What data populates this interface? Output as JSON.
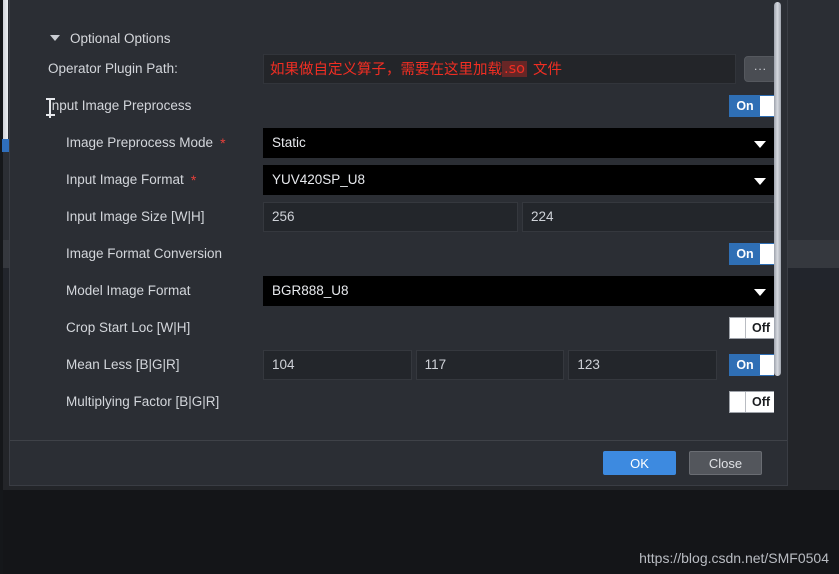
{
  "dialog": {
    "section_header": "Optional Options",
    "rows": [
      {
        "label": "Operator Plugin Path:",
        "type": "path",
        "value_prefix": "如果做自定义算子，需要在这里加载",
        "value_selected": ".so",
        "value_suffix": "文件",
        "browse_label": "..."
      },
      {
        "label": "Input Image Preprocess",
        "type": "toggle",
        "toggle_state": "On",
        "required": false,
        "indent": false
      },
      {
        "label": "Image Preprocess Mode",
        "type": "combo",
        "value": "Static",
        "required": true,
        "indent": true
      },
      {
        "label": "Input Image Format",
        "type": "combo",
        "value": "YUV420SP_U8",
        "required": true,
        "indent": true
      },
      {
        "label": "Input Image Size [W|H]",
        "type": "inputs",
        "values": [
          "256",
          "224"
        ],
        "required": false,
        "indent": true
      },
      {
        "label": "Image Format Conversion",
        "type": "toggle",
        "toggle_state": "On",
        "required": false,
        "indent": true
      },
      {
        "label": "Model Image Format",
        "type": "combo",
        "value": "BGR888_U8",
        "required": false,
        "indent": true
      },
      {
        "label": "Crop Start Loc [W|H]",
        "type": "toggle",
        "toggle_state": "Off",
        "required": false,
        "indent": true
      },
      {
        "label": "Mean Less [B|G|R]",
        "type": "inputs-toggle",
        "values": [
          "104",
          "117",
          "123"
        ],
        "toggle_state": "On",
        "required": false,
        "indent": true
      },
      {
        "label": "Multiplying Factor [B|G|R]",
        "type": "toggle",
        "toggle_state": "Off",
        "required": false,
        "indent": true
      }
    ],
    "footer": {
      "ok_label": "OK",
      "close_label": "Close"
    }
  },
  "watermark": "https://blog.csdn.net/SMF0504",
  "colors": {
    "accent_blue": "#3d8ae0",
    "toggle_on_blue": "#2f6fb5",
    "required_red": "#e8403a",
    "hint_red": "#f02e23",
    "dialog_bg": "#2b2e34",
    "combo_bg": "#000000"
  }
}
